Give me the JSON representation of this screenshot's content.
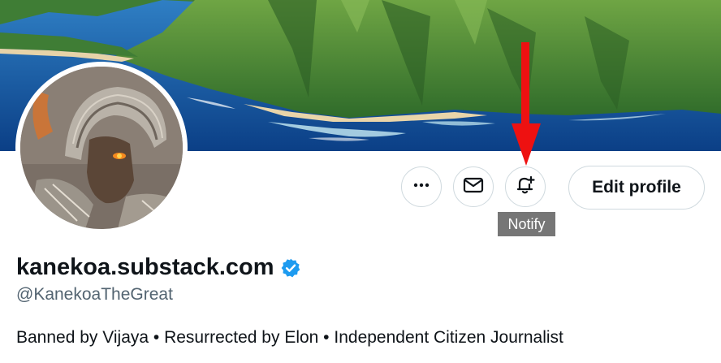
{
  "profile": {
    "display_name": "kanekoa.substack.com",
    "handle": "@KanekoaTheGreat",
    "bio": "Banned by Vijaya • Resurrected by Elon • Independent Citizen Journalist",
    "verified": true
  },
  "actions": {
    "more_icon": "more-horizontal-icon",
    "message_icon": "envelope-icon",
    "notify_icon": "bell-plus-icon",
    "edit_profile_label": "Edit profile",
    "notify_tooltip": "Notify"
  },
  "colors": {
    "verified_badge": "#1d9bf0",
    "arrow": "#ee1111",
    "tooltip_bg": "#767676",
    "text_primary": "#0f1419",
    "text_secondary": "#536471"
  }
}
